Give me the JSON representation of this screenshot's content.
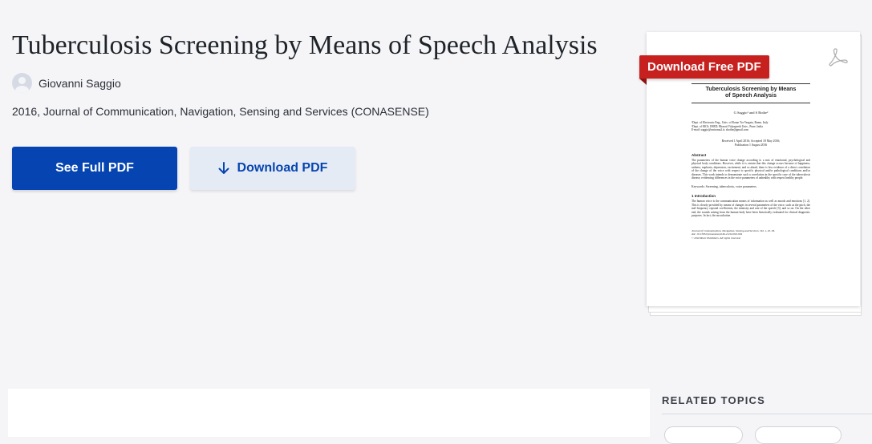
{
  "paper": {
    "title": "Tuberculosis Screening by Means of Speech Analysis",
    "author": "Giovanni Saggio",
    "venue": "2016, Journal of Communication, Navigation, Sensing and Services (CONASENSE)"
  },
  "actions": {
    "see_full_pdf": "See Full PDF",
    "download_pdf": "Download PDF",
    "download_free_pdf": "Download Free PDF"
  },
  "preview": {
    "title_line1": "Tuberculosis Screening by Means",
    "title_line2": "of Speech Analysis",
    "authors": "G Saggio¹ and S Bothe²",
    "aff1": "¹Dept. of Electronic Eng., Univ. of Rome Tor Vergata, Rome, Italy",
    "aff2": "²Dept. of MCS, IMED, Bharati Vidyapeeth Univ., Pune, India",
    "aff3": "E-mail: saggio@uniroma2.it; sbothe@gmail.com",
    "received": "Received 1 April 2016; Accepted 18 May 2016;",
    "published": "Publication 1 August 2016",
    "abstract_head": "Abstract",
    "abstract_text": "The parameters of the human voice change according to a mix of emotional, psychological and physical body conditions. However, while it is certain that this change occurs because of happiness, sadness, euphoria, depression, excitement, and so ahead, there is less evidence of a direct correlation of the change of the voice with respect to specific physical and/or pathological conditions and/or diseases. This work intends to demonstrate such a correlation in the specific case of the tuberculosis disease, evidencing differences in the voice parameters of unhealthy with respect healthy people.",
    "keywords": "Keywords: Screening, tuberculosis, voice parameters.",
    "intro_head": "1  Introduction",
    "intro_text": "The human voice is the communication means of information as well as moods and emotions [1, 2]. This is clearly provided by means of changes in several parameters of the voice, such as the pitch, the mel-frequency cepstral coefficients, the intensity and rate of the speech [3], and so on. On the other end, the sounds arising from the human body have been historically evaluated for clinical diagnostic purposes. In fact, the auscultation",
    "footer1": "Journal of Communication, Navigation, Sensing and Services, Vol. 1, 45–56.",
    "footer2": "doi: 10.13052/jconasense2246-2120.2016.004",
    "footer3": "© 2016 River Publishers. All rights reserved."
  },
  "related": {
    "heading": "RELATED TOPICS"
  },
  "colors": {
    "primary": "#0645b1",
    "secondary_bg": "#e5ebf5",
    "badge_red": "#c7211f",
    "page_bg": "#f5f5f8"
  },
  "icons": [
    "user-avatar-icon",
    "download-arrow-icon",
    "pdf-file-icon"
  ]
}
